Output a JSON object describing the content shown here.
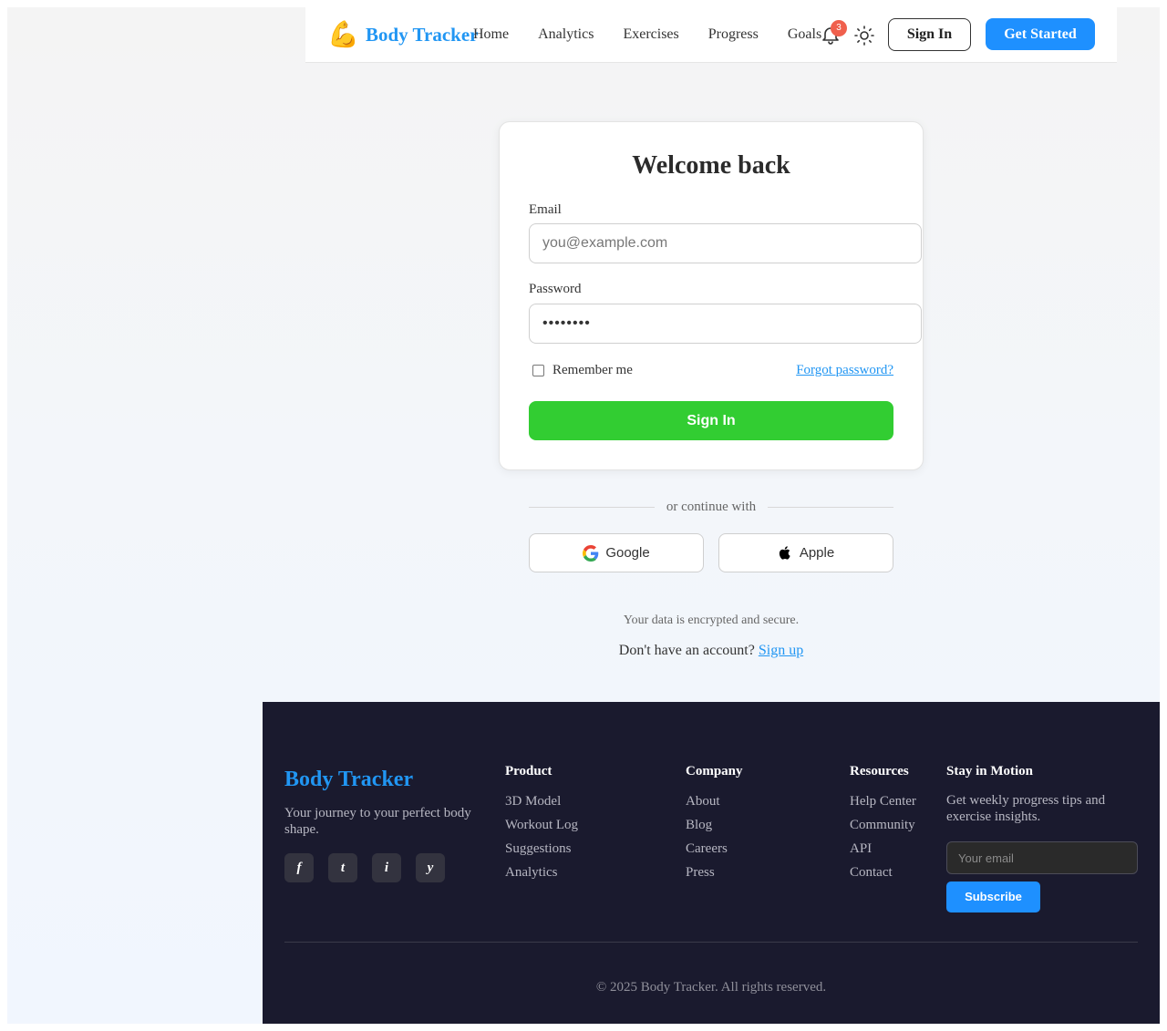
{
  "brand": {
    "emoji": "💪",
    "name": "Body Tracker",
    "accent": "#2196f3"
  },
  "nav": {
    "items": [
      "Home",
      "Analytics",
      "Exercises",
      "Progress",
      "Goals"
    ]
  },
  "header": {
    "notification_count": "3",
    "bell_icon": "bell-icon",
    "theme_icon": "sun-icon",
    "sign_in_label": "Sign In",
    "get_started_label": "Get Started"
  },
  "login": {
    "title": "Welcome back",
    "email_label": "Email",
    "email_placeholder": "you@example.com",
    "password_label": "Password",
    "password_value": "••••••••",
    "remember_label": "Remember me",
    "forgot_label": "Forgot password?",
    "submit_label": "Sign In",
    "submit_color": "#32cd32"
  },
  "social": {
    "divider_text": "or continue with",
    "google_label": "Google",
    "apple_label": "Apple"
  },
  "secure_note": "Your data is encrypted and secure.",
  "signup": {
    "prompt": "Don't have an account?",
    "link": "Sign up"
  },
  "footer": {
    "brand": "Body Tracker",
    "tagline": "Your journey to your perfect body shape.",
    "socials": [
      "f",
      "t",
      "i",
      "y"
    ],
    "columns": [
      {
        "title": "Product",
        "links": [
          "3D Model",
          "Workout Log",
          "Suggestions",
          "Analytics"
        ]
      },
      {
        "title": "Company",
        "links": [
          "About",
          "Blog",
          "Careers",
          "Press"
        ]
      },
      {
        "title": "Resources",
        "links": [
          "Help Center",
          "Community",
          "API",
          "Contact"
        ]
      }
    ],
    "newsletter": {
      "title": "Stay in Motion",
      "text": "Get weekly progress tips and exercise insights.",
      "placeholder": "Your email",
      "button": "Subscribe"
    },
    "copyright": "© 2025 Body Tracker. All rights reserved.",
    "background": "#1a1a2e"
  }
}
